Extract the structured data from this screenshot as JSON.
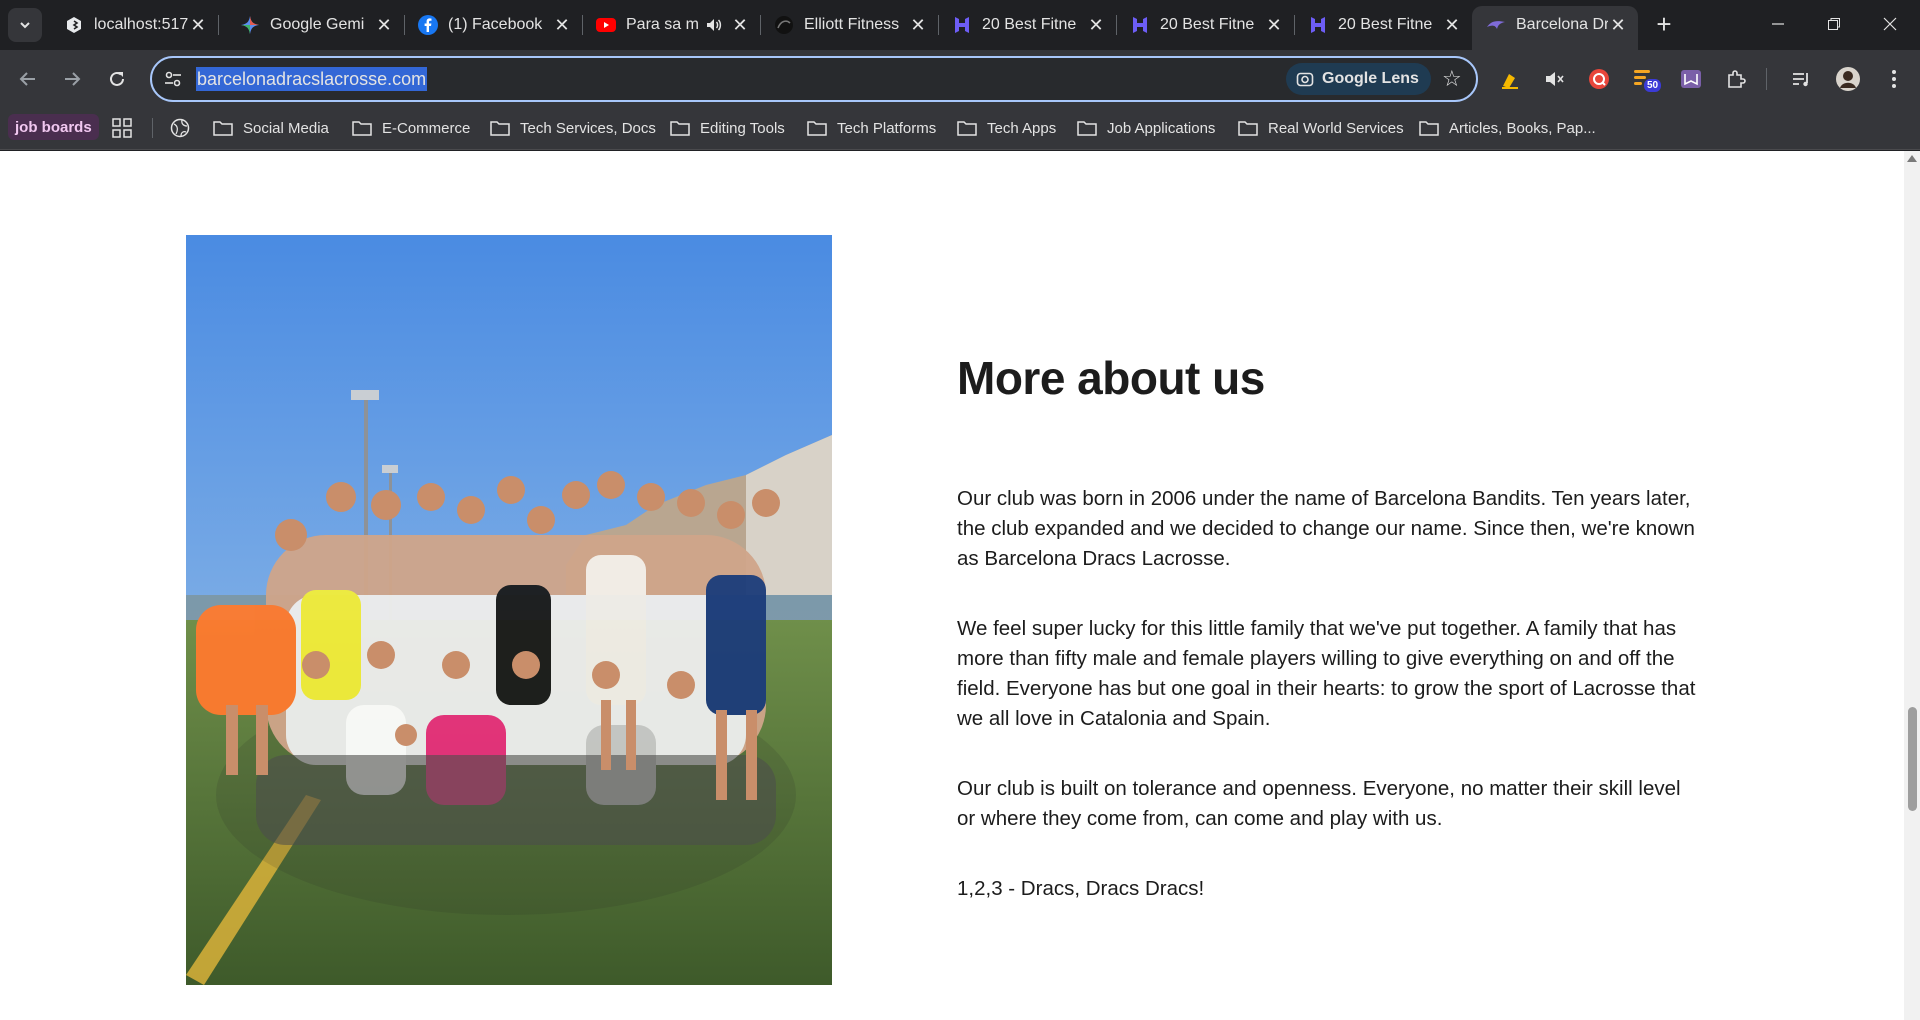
{
  "browser": {
    "tabs": [
      {
        "title": "localhost:517",
        "favicon": "localhost-icon"
      },
      {
        "title": "Google Gemi",
        "favicon": "gemini-icon"
      },
      {
        "title": "(1) Facebook",
        "favicon": "facebook-icon"
      },
      {
        "title": "Para sa m",
        "favicon": "youtube-icon",
        "audio": true
      },
      {
        "title": "Elliott Fitness",
        "favicon": "circle-logo-icon"
      },
      {
        "title": "20 Best Fitne",
        "favicon": "h-logo-icon"
      },
      {
        "title": "20 Best Fitne",
        "favicon": "h-logo-icon"
      },
      {
        "title": "20 Best Fitne",
        "favicon": "h-logo-icon"
      },
      {
        "title": "Barcelona Dr",
        "favicon": "dragon-icon",
        "active": true
      }
    ],
    "url": "barcelonadracslacrosse.com",
    "lens_label": "Google Lens",
    "extension_badge": "50",
    "bookmarks": {
      "tag": "job boards",
      "folders": [
        "Social Media",
        "E-Commerce",
        "Tech Services, Docs",
        "Editing Tools",
        "Tech Platforms",
        "Tech Apps",
        "Job Applications",
        "Real World Services",
        "Articles, Books, Pap..."
      ]
    }
  },
  "content": {
    "heading": "More about us",
    "paragraphs": [
      "Our club was born in 2006 under the name of Barcelona Bandits. Ten years later, the club expanded and we decided to change our name. Since then, we're known as Barcelona Dracs Lacrosse.",
      "We feel super lucky for this little family that we've put together. A family that has more than fifty male and female players willing to give everything on and off the field. Everyone has but one goal in their hearts: to grow the sport of Lacrosse that we all love in Catalonia and Spain.",
      "Our club is built on tolerance and openness. Everyone, no matter their skill level or where they come from, can come and play with us.",
      "1,2,3 - Dracs, Dracs Dracs!"
    ]
  },
  "colors": {
    "accent": "#a8c7fa",
    "url_highlight": "#3367d6",
    "page_bg": "#ffffff",
    "text": "#1c1c1c"
  }
}
